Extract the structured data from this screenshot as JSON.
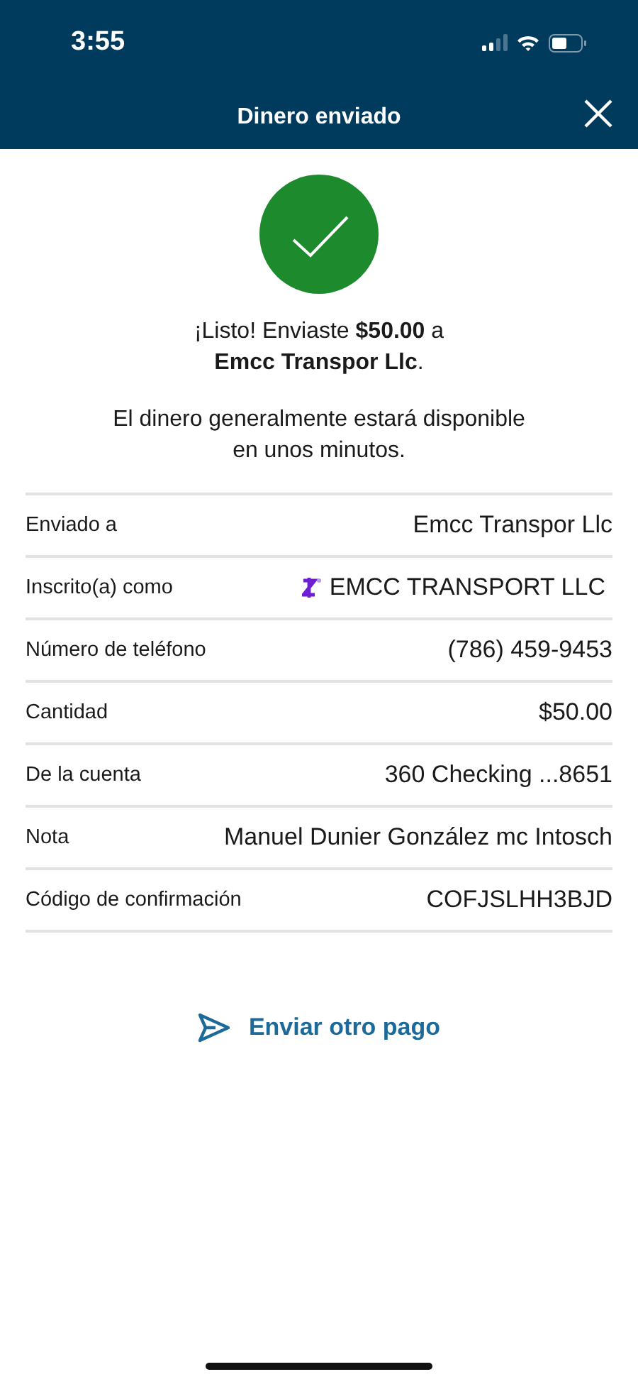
{
  "status_bar": {
    "time": "3:55"
  },
  "header": {
    "title": "Dinero enviado"
  },
  "confirmation": {
    "message": "¡Listo! Enviaste **$50.00** a\n**Emcc Transpor Llc**.",
    "note": "El dinero generalmente estará disponible\nen unos minutos."
  },
  "details": [
    {
      "kind": "plain",
      "label": "Enviado a",
      "value": "Emcc Transpor Llc"
    },
    {
      "kind": "zelle",
      "label": "Inscrito(a) como",
      "value": "EMCC TRANSPORT LLC"
    },
    {
      "kind": "plain",
      "label": "Número de teléfono",
      "value": "(786) 459-9453"
    },
    {
      "kind": "plain",
      "label": "Cantidad",
      "value": "$50.00"
    },
    {
      "kind": "plain",
      "label": "De la cuenta",
      "value": "360 Checking ...8651"
    },
    {
      "kind": "plain",
      "label": "Nota",
      "value": "Manuel Dunier González mc Intosch"
    },
    {
      "kind": "plain",
      "label": "Código de confirmación",
      "value": "COFJSLHH3BJD"
    }
  ],
  "action": {
    "label": "Enviar otro pago"
  }
}
